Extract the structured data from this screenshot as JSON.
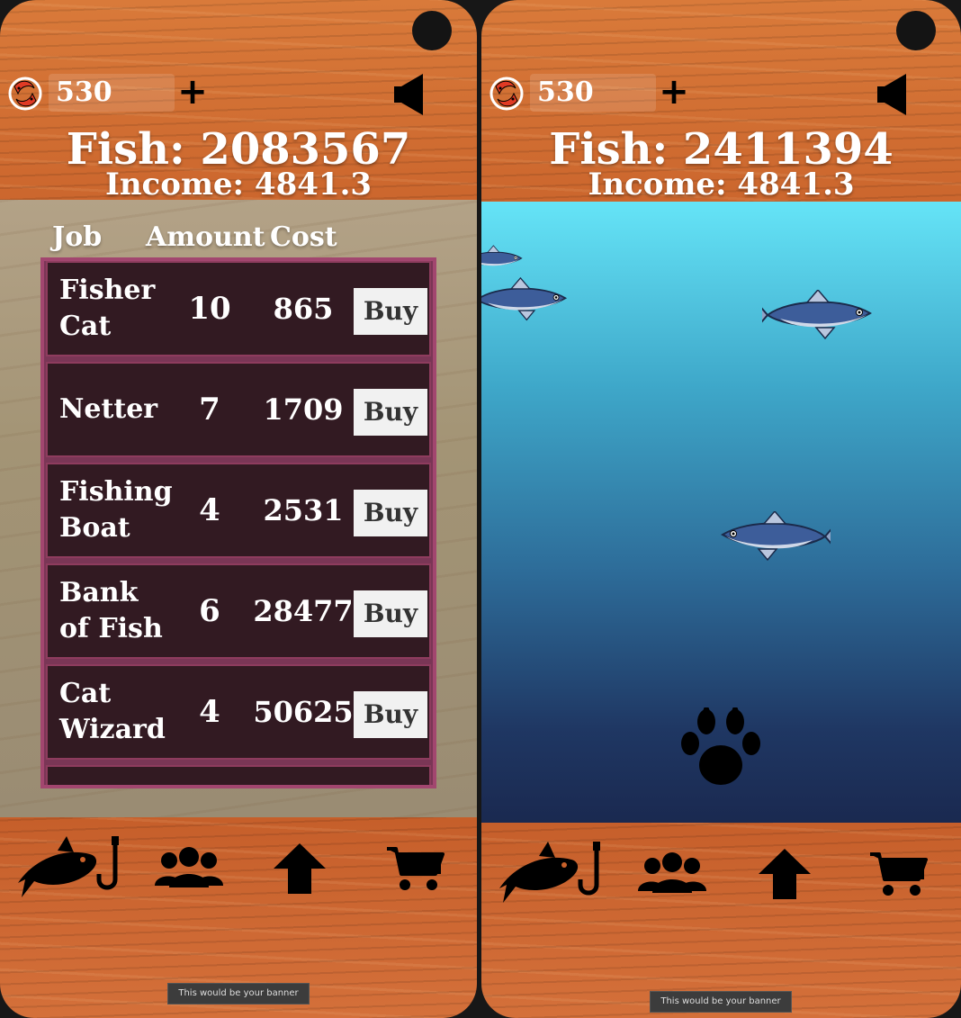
{
  "currency": {
    "gems": "530",
    "add_label": "+"
  },
  "left_screen": {
    "fish_count": "Fish: 2083567",
    "income": "Income: 4841.3",
    "columns": {
      "job": "Job",
      "amount": "Amount",
      "cost": "Cost"
    },
    "jobs": [
      {
        "name": "Fisher Cat",
        "amount": "10",
        "cost": "865",
        "buy_label": "Buy"
      },
      {
        "name": "Netter",
        "amount": "7",
        "cost": "1709",
        "buy_label": "Buy"
      },
      {
        "name": "Fishing Boat",
        "amount": "4",
        "cost": "2531",
        "buy_label": "Buy"
      },
      {
        "name": "Bank of Fish",
        "amount": "6",
        "cost": "28477",
        "buy_label": "Buy"
      },
      {
        "name": "Cat Wizard",
        "amount": "4",
        "cost": "50625",
        "buy_label": "Buy"
      }
    ],
    "banner": "This would be your banner"
  },
  "right_screen": {
    "fish_count": "Fish: 2411394",
    "income": "Income: 4841.3",
    "banner": "This would be your banner"
  },
  "nav_icons": [
    "fishing-icon",
    "workers-icon",
    "upgrade-arrow-icon",
    "shop-cart-icon"
  ],
  "colors": {
    "wood": "#c8612a",
    "list_border": "#a2466f",
    "row_bg": "#321a22",
    "ocean_top": "#65e4f7",
    "ocean_bottom": "#1a2950"
  }
}
